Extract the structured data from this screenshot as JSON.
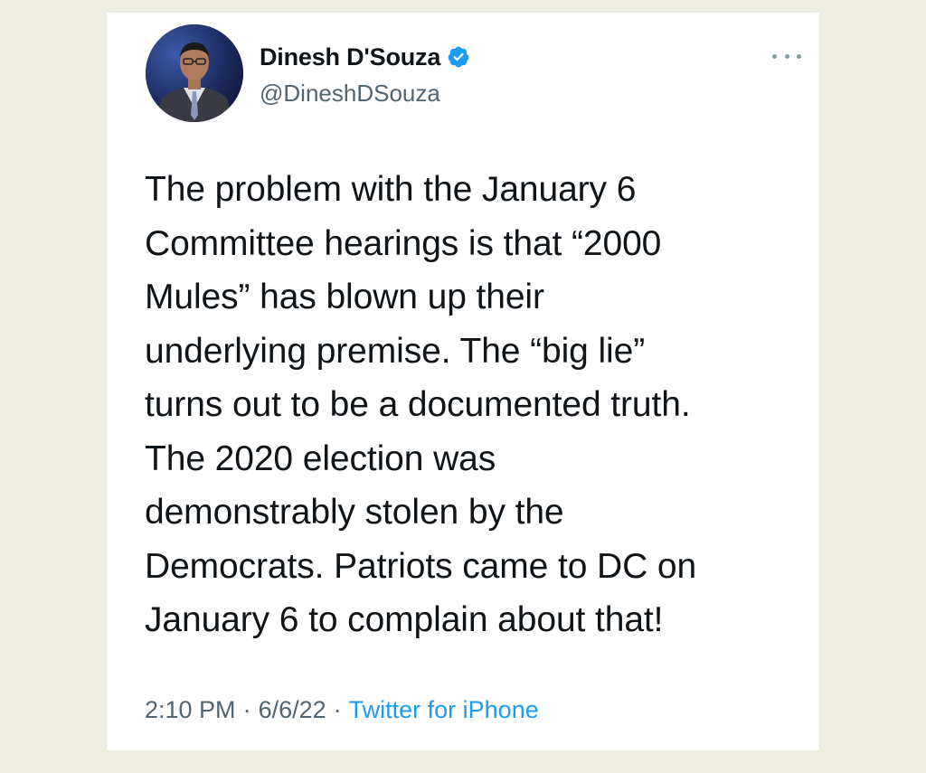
{
  "tweet": {
    "author": {
      "display_name": "Dinesh D'Souza",
      "handle": "@DineshDSouza",
      "verified": true,
      "avatar_icon": "profile-photo"
    },
    "text": "The problem with the January 6\nCommittee hearings is that “2000\nMules” has blown up their\nunderlying premise. The “big lie”\nturns out to be a documented truth.\nThe 2020 election was\ndemonstrably stolen by the\nDemocrats. Patriots came to DC on\nJanuary 6 to complain about that!",
    "time": "2:10 PM",
    "separator": "·",
    "date": "6/6/22",
    "source": "Twitter for iPhone"
  },
  "colors": {
    "background": "#efeee2",
    "card": "#ffffff",
    "text": "#0f1419",
    "muted": "#536471",
    "accent": "#1d9bf0"
  }
}
